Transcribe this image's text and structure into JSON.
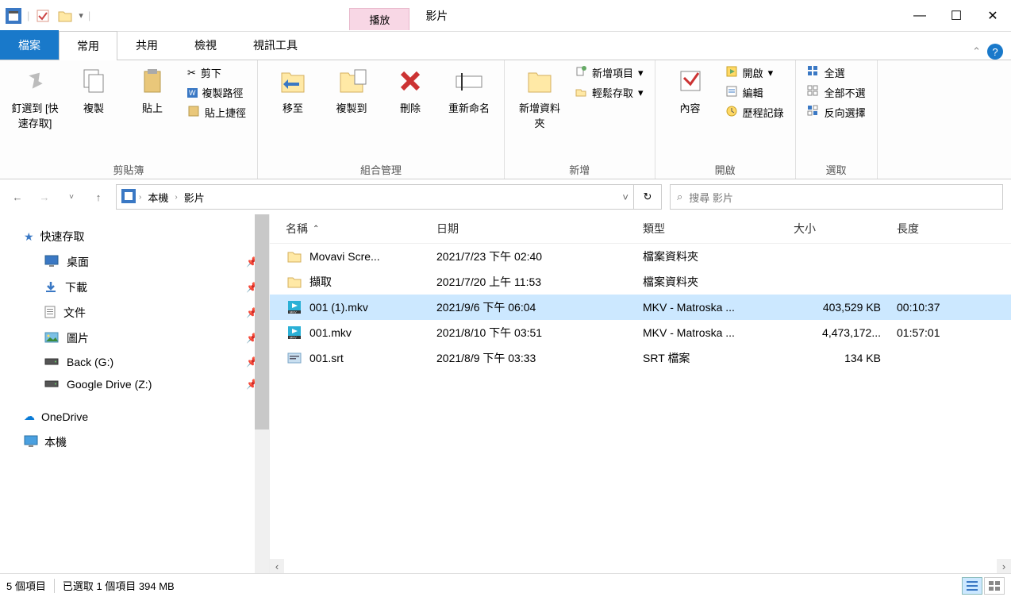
{
  "titlebar": {
    "context_tab": "播放",
    "title": "影片"
  },
  "tabs": {
    "file": "檔案",
    "home": "常用",
    "share": "共用",
    "view": "檢視",
    "video_tools": "視訊工具"
  },
  "ribbon": {
    "clipboard": {
      "pin": "釘選到 [快速存取]",
      "copy": "複製",
      "paste": "貼上",
      "cut": "剪下",
      "copy_path": "複製路徑",
      "paste_shortcut": "貼上捷徑",
      "label": "剪貼簿"
    },
    "organize": {
      "move_to": "移至",
      "copy_to": "複製到",
      "delete": "刪除",
      "rename": "重新命名",
      "label": "組合管理"
    },
    "new": {
      "new_folder": "新增資料夾",
      "new_item": "新增項目",
      "easy_access": "輕鬆存取",
      "label": "新增"
    },
    "open": {
      "properties": "內容",
      "open": "開啟",
      "edit": "編輯",
      "history": "歷程記錄",
      "label": "開啟"
    },
    "select": {
      "all": "全選",
      "none": "全部不選",
      "invert": "反向選擇",
      "label": "選取"
    }
  },
  "address": {
    "seg1": "本機",
    "seg2": "影片"
  },
  "search": {
    "placeholder": "搜尋 影片"
  },
  "tree": {
    "quick_access": "快速存取",
    "items": [
      {
        "label": "桌面",
        "icon": "desktop"
      },
      {
        "label": "下載",
        "icon": "download"
      },
      {
        "label": "文件",
        "icon": "document"
      },
      {
        "label": "圖片",
        "icon": "pictures"
      },
      {
        "label": "Back (G:)",
        "icon": "drive"
      },
      {
        "label": "Google Drive (Z:)",
        "icon": "drive"
      }
    ],
    "onedrive": "OneDrive",
    "thispc": "本機"
  },
  "columns": {
    "name": "名稱",
    "date": "日期",
    "type": "類型",
    "size": "大小",
    "length": "長度"
  },
  "files": [
    {
      "icon": "folder",
      "name": "Movavi Scre...",
      "date": "2021/7/23 下午 02:40",
      "type": "檔案資料夾",
      "size": "",
      "length": "",
      "selected": false
    },
    {
      "icon": "folder",
      "name": "擷取",
      "date": "2021/7/20 上午 11:53",
      "type": "檔案資料夾",
      "size": "",
      "length": "",
      "selected": false
    },
    {
      "icon": "mkv",
      "name": "001 (1).mkv",
      "date": "2021/9/6 下午 06:04",
      "type": "MKV - Matroska ...",
      "size": "403,529 KB",
      "length": "00:10:37",
      "selected": true
    },
    {
      "icon": "mkv",
      "name": "001.mkv",
      "date": "2021/8/10 下午 03:51",
      "type": "MKV - Matroska ...",
      "size": "4,473,172...",
      "length": "01:57:01",
      "selected": false
    },
    {
      "icon": "srt",
      "name": "001.srt",
      "date": "2021/8/9 下午 03:33",
      "type": "SRT 檔案",
      "size": "134 KB",
      "length": "",
      "selected": false
    }
  ],
  "status": {
    "count": "5 個項目",
    "selected": "已選取 1 個項目 394 MB"
  }
}
